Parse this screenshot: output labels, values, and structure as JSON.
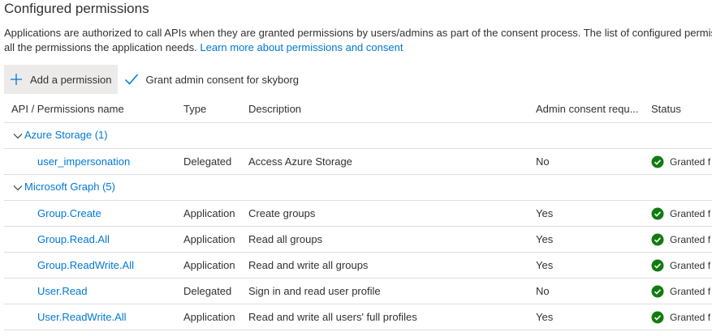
{
  "section": {
    "title": "Configured permissions",
    "description_line1": "Applications are authorized to call APIs when they are granted permissions by users/admins as part of the consent process. The list of configured permiss",
    "description_line2": "all the permissions the application needs.",
    "learn_more": "Learn more about permissions and consent"
  },
  "toolbar": {
    "add_label": "Add a permission",
    "add_icon": "plus-icon",
    "consent_label": "Grant admin consent for skyborg",
    "consent_icon": "checkmark-icon"
  },
  "table": {
    "headers": [
      "API / Permissions name",
      "Type",
      "Description",
      "Admin consent requ...",
      "Status"
    ],
    "groups": [
      {
        "name": "Azure Storage (1)",
        "rows": [
          {
            "name": "user_impersonation",
            "type": "Delegated",
            "description": "Access Azure Storage",
            "admin": "No",
            "status": "Granted f"
          }
        ]
      },
      {
        "name": "Microsoft Graph (5)",
        "rows": [
          {
            "name": "Group.Create",
            "type": "Application",
            "description": "Create groups",
            "admin": "Yes",
            "status": "Granted f"
          },
          {
            "name": "Group.Read.All",
            "type": "Application",
            "description": "Read all groups",
            "admin": "Yes",
            "status": "Granted f"
          },
          {
            "name": "Group.ReadWrite.All",
            "type": "Application",
            "description": "Read and write all groups",
            "admin": "Yes",
            "status": "Granted f"
          },
          {
            "name": "User.Read",
            "type": "Delegated",
            "description": "Sign in and read user profile",
            "admin": "No",
            "status": "Granted f"
          },
          {
            "name": "User.ReadWrite.All",
            "type": "Application",
            "description": "Read and write all users' full profiles",
            "admin": "Yes",
            "status": "Granted f"
          }
        ]
      }
    ]
  },
  "colors": {
    "link": "#0078d4",
    "success": "#107c10",
    "border": "#e1dfdd",
    "button_bg": "#edebe9"
  }
}
